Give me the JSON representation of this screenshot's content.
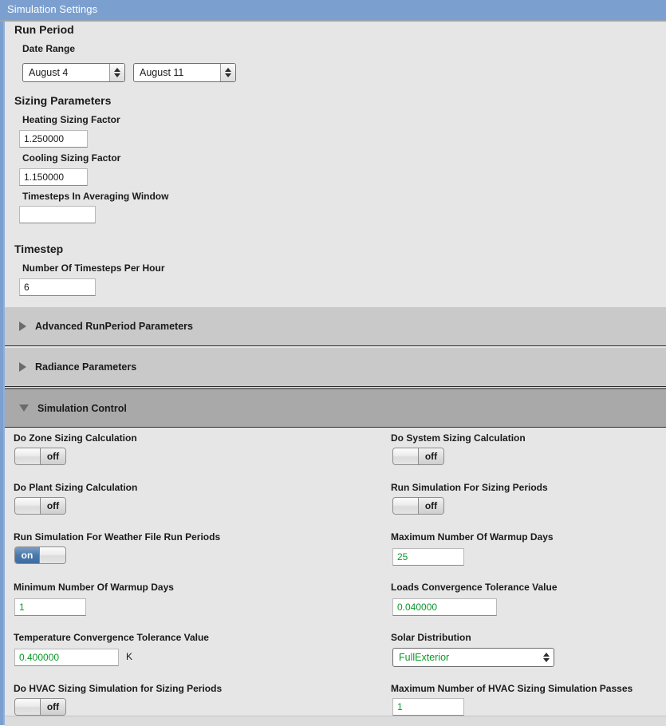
{
  "window": {
    "title": "Simulation Settings"
  },
  "run_period": {
    "heading": "Run Period",
    "date_range_label": "Date Range",
    "begin_date": "August 4",
    "end_date": "August 11"
  },
  "sizing_parameters": {
    "heading": "Sizing Parameters",
    "heating_sizing_factor_label": "Heating Sizing Factor",
    "heating_sizing_factor_value": "1.250000",
    "cooling_sizing_factor_label": "Cooling Sizing Factor",
    "cooling_sizing_factor_value": "1.150000",
    "timesteps_averaging_label": "Timesteps In Averaging Window",
    "timesteps_averaging_value": ""
  },
  "timestep": {
    "heading": "Timestep",
    "timesteps_per_hour_label": "Number Of Timesteps Per Hour",
    "timesteps_per_hour_value": "6"
  },
  "sections": [
    {
      "label": "Advanced RunPeriod Parameters",
      "expanded": false,
      "icon": "triangle-right-icon"
    },
    {
      "label": "Radiance Parameters",
      "expanded": false,
      "icon": "triangle-right-icon"
    },
    {
      "label": "Simulation Control",
      "expanded": true,
      "icon": "triangle-down-icon"
    }
  ],
  "simulation_control": {
    "do_zone_sizing": {
      "label": "Do Zone Sizing Calculation",
      "state": "off"
    },
    "do_system_sizing": {
      "label": "Do System Sizing Calculation",
      "state": "off"
    },
    "do_plant_sizing": {
      "label": "Do Plant Sizing Calculation",
      "state": "off"
    },
    "run_sim_sizing_periods": {
      "label": "Run Simulation For Sizing Periods",
      "state": "off"
    },
    "run_sim_weather_file": {
      "label": "Run Simulation For Weather File Run Periods",
      "state": "on"
    },
    "max_warmup_days": {
      "label": "Maximum Number Of Warmup Days",
      "value": "25"
    },
    "min_warmup_days": {
      "label": "Minimum Number Of Warmup Days",
      "value": "1"
    },
    "loads_convergence": {
      "label": "Loads Convergence Tolerance Value",
      "value": "0.040000"
    },
    "temperature_convergence": {
      "label": "Temperature Convergence Tolerance Value",
      "value": "0.400000",
      "unit": "K"
    },
    "solar_distribution": {
      "label": "Solar Distribution",
      "value": "FullExterior"
    },
    "do_hvac_sizing_sim": {
      "label": "Do HVAC Sizing Simulation for Sizing Periods",
      "state": "off"
    },
    "max_hvac_passes": {
      "label": "Maximum Number of HVAC Sizing Simulation Passes",
      "value": "1"
    }
  },
  "colors": {
    "titlebar": "#7ba0d0",
    "panel": "#e6e6e6",
    "section_collapsed": "#c9c9c9",
    "section_expanded": "#a9a9a9",
    "value_green": "#0a9a28",
    "toggle_on": "#4a79ab"
  }
}
